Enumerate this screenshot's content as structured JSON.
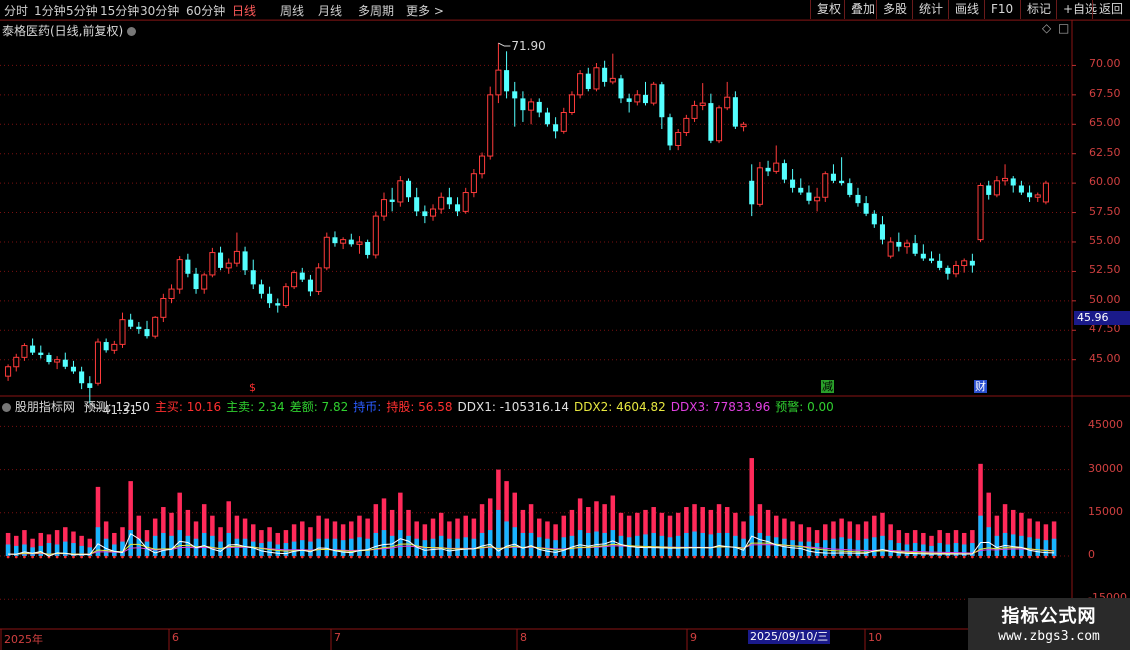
{
  "toolbar": {
    "periods": [
      "分时",
      "1分钟",
      "5分钟",
      "15分钟",
      "30分钟",
      "60分钟",
      "日线",
      "周线",
      "月线",
      "多周期",
      "更多 >"
    ],
    "active_period": "日线",
    "right_buttons": [
      "复权",
      "叠加",
      "多股",
      "统计",
      "画线",
      "F10",
      "标记",
      "+自选",
      "返回"
    ]
  },
  "chart_title": {
    "name": "泰格医药(日线,前复权)"
  },
  "price_panel": {
    "high_label": "71.90",
    "low_label": "41.31",
    "current_price": "45.96",
    "y_ticks": [
      "70.00",
      "67.50",
      "65.00",
      "62.50",
      "60.00",
      "57.50",
      "55.00",
      "52.50",
      "50.00",
      "47.50",
      "45.00"
    ],
    "markers": {
      "s_label": "$",
      "jian_label": "减",
      "cai_label": "财"
    }
  },
  "indicator": {
    "name": "股朋指标网",
    "fields": [
      {
        "label": "预测:",
        "value": "12.50",
        "color": "#e0e0e0"
      },
      {
        "label": "主买:",
        "value": "10.16",
        "color": "#ff3030"
      },
      {
        "label": "主卖:",
        "value": "2.34",
        "color": "#30d030"
      },
      {
        "label": "差额:",
        "value": "7.82",
        "color": "#30d030"
      },
      {
        "label": "持币:",
        "value": "",
        "color": "#2a5cff"
      },
      {
        "label": "持股:",
        "value": "56.58",
        "color": "#ff3030"
      },
      {
        "label": "DDX1:",
        "value": "-105316.14",
        "color": "#e0e0e0"
      },
      {
        "label": "DDX2:",
        "value": "4604.82",
        "color": "#e8e840"
      },
      {
        "label": "DDX3:",
        "value": "77833.96",
        "color": "#e040e0"
      },
      {
        "label": "预警:",
        "value": "0.00",
        "color": "#30d030"
      }
    ],
    "y_ticks": [
      "45000",
      "30000",
      "15000",
      "0",
      "-15000"
    ]
  },
  "x_axis": {
    "labels": [
      "2025年",
      "6",
      "7",
      "8",
      "9",
      "10"
    ],
    "cursor_date": "2025/09/10/三"
  },
  "watermark": {
    "line1": "指标公式网",
    "line2": "www.zbgs3.com"
  },
  "colors": {
    "up": "#ff3b3b",
    "down": "#54ffff",
    "grid": "#7a1010",
    "bar_red": "#ff2a5a",
    "bar_blue": "#19b4ff"
  },
  "chart_data": [
    {
      "type": "candlestick",
      "title": "泰格医药(日线,前复权)",
      "ylim": [
        42,
        72.5
      ],
      "y_ticks": [
        45.0,
        47.5,
        50.0,
        52.5,
        55.0,
        57.5,
        60.0,
        62.5,
        65.0,
        67.5,
        70.0
      ],
      "ohlc": [
        [
          43.6,
          44.6,
          43.2,
          44.4
        ],
        [
          44.4,
          45.5,
          44.0,
          45.2
        ],
        [
          45.2,
          46.4,
          44.9,
          46.2
        ],
        [
          46.2,
          46.8,
          45.4,
          45.6
        ],
        [
          45.6,
          46.2,
          45.1,
          45.4
        ],
        [
          45.4,
          45.6,
          44.6,
          44.8
        ],
        [
          44.8,
          45.3,
          44.2,
          45.0
        ],
        [
          45.0,
          45.6,
          44.2,
          44.4
        ],
        [
          44.4,
          44.9,
          43.8,
          44.0
        ],
        [
          44.0,
          44.4,
          42.5,
          43.0
        ],
        [
          43.0,
          43.6,
          41.31,
          42.6
        ],
        [
          43.0,
          46.8,
          42.8,
          46.5
        ],
        [
          46.5,
          46.8,
          45.6,
          45.8
        ],
        [
          45.8,
          46.6,
          45.5,
          46.3
        ],
        [
          46.3,
          49.0,
          46.0,
          48.4
        ],
        [
          48.4,
          48.9,
          47.6,
          47.8
        ],
        [
          47.8,
          48.2,
          47.2,
          47.6
        ],
        [
          47.6,
          48.3,
          46.8,
          47.0
        ],
        [
          47.0,
          48.7,
          46.8,
          48.6
        ],
        [
          48.6,
          50.6,
          48.2,
          50.2
        ],
        [
          50.2,
          51.4,
          49.8,
          51.0
        ],
        [
          51.0,
          53.8,
          50.6,
          53.5
        ],
        [
          53.5,
          54.0,
          52.0,
          52.3
        ],
        [
          52.3,
          52.8,
          50.6,
          51.0
        ],
        [
          51.0,
          52.4,
          50.6,
          52.2
        ],
        [
          52.2,
          54.5,
          52.0,
          54.1
        ],
        [
          54.1,
          54.6,
          52.6,
          52.8
        ],
        [
          52.8,
          53.6,
          52.3,
          53.2
        ],
        [
          53.2,
          55.8,
          52.9,
          54.2
        ],
        [
          54.2,
          54.6,
          52.2,
          52.6
        ],
        [
          52.6,
          53.5,
          51.0,
          51.4
        ],
        [
          51.4,
          51.8,
          50.2,
          50.6
        ],
        [
          50.6,
          51.2,
          49.4,
          49.8
        ],
        [
          49.8,
          50.2,
          49.0,
          49.6
        ],
        [
          49.6,
          51.5,
          49.4,
          51.2
        ],
        [
          51.2,
          52.6,
          51.0,
          52.4
        ],
        [
          52.4,
          52.8,
          51.6,
          51.8
        ],
        [
          51.8,
          52.2,
          50.4,
          50.8
        ],
        [
          50.8,
          53.2,
          50.5,
          52.8
        ],
        [
          52.8,
          55.8,
          52.6,
          55.4
        ],
        [
          55.4,
          55.9,
          54.6,
          54.9
        ],
        [
          54.9,
          55.4,
          54.4,
          55.2
        ],
        [
          55.2,
          55.7,
          54.6,
          54.8
        ],
        [
          54.8,
          55.5,
          54.0,
          55.0
        ],
        [
          55.0,
          55.2,
          53.6,
          53.9
        ],
        [
          53.9,
          57.6,
          53.6,
          57.2
        ],
        [
          57.2,
          59.2,
          56.8,
          58.6
        ],
        [
          58.6,
          59.6,
          57.6,
          58.4
        ],
        [
          58.4,
          60.6,
          58.0,
          60.2
        ],
        [
          60.2,
          60.4,
          58.4,
          58.8
        ],
        [
          58.8,
          59.6,
          57.2,
          57.6
        ],
        [
          57.6,
          58.1,
          56.6,
          57.2
        ],
        [
          57.2,
          58.2,
          56.8,
          57.8
        ],
        [
          57.8,
          59.2,
          57.4,
          58.8
        ],
        [
          58.8,
          59.6,
          57.8,
          58.2
        ],
        [
          58.2,
          58.8,
          57.2,
          57.6
        ],
        [
          57.6,
          59.6,
          57.4,
          59.2
        ],
        [
          59.2,
          61.2,
          58.8,
          60.8
        ],
        [
          60.8,
          62.6,
          60.4,
          62.3
        ],
        [
          62.3,
          68.2,
          62.0,
          67.5
        ],
        [
          67.5,
          71.9,
          66.8,
          69.6
        ],
        [
          69.6,
          71.2,
          67.2,
          67.8
        ],
        [
          67.8,
          68.6,
          64.8,
          67.2
        ],
        [
          67.2,
          67.8,
          65.2,
          66.2
        ],
        [
          66.2,
          67.2,
          65.0,
          66.9
        ],
        [
          66.9,
          67.2,
          65.6,
          66.0
        ],
        [
          66.0,
          66.4,
          64.8,
          65.0
        ],
        [
          65.0,
          65.6,
          63.8,
          64.4
        ],
        [
          64.4,
          66.4,
          64.2,
          66.0
        ],
        [
          66.0,
          67.8,
          65.8,
          67.5
        ],
        [
          67.5,
          69.6,
          67.2,
          69.3
        ],
        [
          69.3,
          69.8,
          67.8,
          68.0
        ],
        [
          68.0,
          70.2,
          67.8,
          69.8
        ],
        [
          69.8,
          70.4,
          68.2,
          68.6
        ],
        [
          68.6,
          71.0,
          68.4,
          68.9
        ],
        [
          68.9,
          69.2,
          66.8,
          67.2
        ],
        [
          67.2,
          67.6,
          66.0,
          66.9
        ],
        [
          66.9,
          67.9,
          66.6,
          67.5
        ],
        [
          67.5,
          68.6,
          66.6,
          66.8
        ],
        [
          66.8,
          68.6,
          66.6,
          68.4
        ],
        [
          68.4,
          68.6,
          64.6,
          65.6
        ],
        [
          65.6,
          65.9,
          62.8,
          63.2
        ],
        [
          63.2,
          64.6,
          62.8,
          64.3
        ],
        [
          64.3,
          65.8,
          64.0,
          65.5
        ],
        [
          65.5,
          67.0,
          65.2,
          66.6
        ],
        [
          66.6,
          68.5,
          66.2,
          66.8
        ],
        [
          66.8,
          67.6,
          63.4,
          63.6
        ],
        [
          63.6,
          66.6,
          63.4,
          66.4
        ],
        [
          66.4,
          68.6,
          66.2,
          67.3
        ],
        [
          67.3,
          67.8,
          64.6,
          64.8
        ],
        [
          64.8,
          65.2,
          64.4,
          65.0
        ],
        [
          60.2,
          61.6,
          57.2,
          58.2
        ],
        [
          58.2,
          61.8,
          58.0,
          61.3
        ],
        [
          61.3,
          61.9,
          60.6,
          61.0
        ],
        [
          61.0,
          63.2,
          60.8,
          61.7
        ],
        [
          61.7,
          62.0,
          60.0,
          60.3
        ],
        [
          60.3,
          61.2,
          59.2,
          59.6
        ],
        [
          59.6,
          60.4,
          59.0,
          59.2
        ],
        [
          59.2,
          59.8,
          58.2,
          58.5
        ],
        [
          58.5,
          59.6,
          57.6,
          58.8
        ],
        [
          58.8,
          61.0,
          58.4,
          60.8
        ],
        [
          60.8,
          61.6,
          60.0,
          60.2
        ],
        [
          60.2,
          62.2,
          59.8,
          60.0
        ],
        [
          60.0,
          60.4,
          58.8,
          59.0
        ],
        [
          59.0,
          59.6,
          58.0,
          58.3
        ],
        [
          58.3,
          58.9,
          57.2,
          57.4
        ],
        [
          57.4,
          57.7,
          56.2,
          56.5
        ],
        [
          56.5,
          57.2,
          54.8,
          55.2
        ],
        [
          53.8,
          55.4,
          53.6,
          55.0
        ],
        [
          55.0,
          55.8,
          54.2,
          54.6
        ],
        [
          54.6,
          55.2,
          54.0,
          54.9
        ],
        [
          54.9,
          55.6,
          53.8,
          54.0
        ],
        [
          54.0,
          54.8,
          53.4,
          53.6
        ],
        [
          53.6,
          54.2,
          53.2,
          53.4
        ],
        [
          53.4,
          54.0,
          52.6,
          52.8
        ],
        [
          52.8,
          53.0,
          51.8,
          52.3
        ],
        [
          52.3,
          53.4,
          52.0,
          53.0
        ],
        [
          53.0,
          53.6,
          52.4,
          53.4
        ],
        [
          53.4,
          54.0,
          52.4,
          53.0
        ],
        [
          55.2,
          60.0,
          55.0,
          59.8
        ],
        [
          59.8,
          60.2,
          58.6,
          59.0
        ],
        [
          59.0,
          60.6,
          58.8,
          60.2
        ],
        [
          60.2,
          61.6,
          59.8,
          60.4
        ],
        [
          60.4,
          60.6,
          59.2,
          59.8
        ],
        [
          59.8,
          60.2,
          59.0,
          59.2
        ],
        [
          59.2,
          59.8,
          58.4,
          58.8
        ],
        [
          58.8,
          59.2,
          58.4,
          59.0
        ],
        [
          58.4,
          60.2,
          58.2,
          60.0
        ]
      ]
    },
    {
      "type": "bar",
      "title": "股朋指标网",
      "ylim": [
        -25000,
        50000
      ],
      "y_ticks": [
        45000,
        30000,
        15000,
        0,
        -15000
      ],
      "series": [
        {
          "name": "主买",
          "color": "#ff2a5a",
          "values": [
            8000,
            7000,
            9000,
            6000,
            8000,
            7500,
            9000,
            10000,
            8500,
            7000,
            6000,
            24000,
            12000,
            8000,
            10000,
            26000,
            14000,
            9000,
            13000,
            17000,
            15000,
            22000,
            16000,
            12000,
            18000,
            14000,
            10000,
            19000,
            14000,
            13000,
            11000,
            9000,
            10000,
            8000,
            9000,
            11000,
            12000,
            10000,
            14000,
            13000,
            12000,
            11000,
            12000,
            14000,
            13000,
            18000,
            20000,
            16000,
            22000,
            16000,
            12000,
            11000,
            13000,
            15000,
            12000,
            13000,
            14000,
            13000,
            18000,
            20000,
            30000,
            26000,
            22000,
            16000,
            18000,
            13000,
            12000,
            11000,
            14000,
            16000,
            20000,
            17000,
            19000,
            18000,
            21000,
            15000,
            14000,
            15000,
            16000,
            17000,
            15000,
            14000,
            15000,
            17000,
            18000,
            17000,
            16000,
            18000,
            17000,
            15000,
            12000,
            34000,
            18000,
            16000,
            14000,
            13000,
            12000,
            11000,
            10000,
            9000,
            11000,
            12000,
            13000,
            12000,
            11000,
            12000,
            14000,
            15000,
            11000,
            9000,
            8000,
            9000,
            8000,
            7000,
            9000,
            8000,
            9000,
            8000,
            9000,
            32000,
            22000,
            14000,
            18000,
            16000,
            15000,
            13000,
            12000,
            11000,
            12000
          ]
        },
        {
          "name": "主卖",
          "color": "#19b4ff",
          "values": [
            4000,
            3500,
            4000,
            3000,
            3500,
            4500,
            4000,
            5000,
            4500,
            3500,
            3000,
            10000,
            6000,
            4000,
            5000,
            9000,
            6000,
            5000,
            7000,
            8000,
            7000,
            9000,
            7000,
            6000,
            8000,
            7000,
            5000,
            8000,
            6000,
            6000,
            5000,
            4500,
            5000,
            4000,
            4500,
            5000,
            5500,
            5000,
            6000,
            6000,
            6000,
            5500,
            6000,
            6500,
            6000,
            8000,
            9000,
            7000,
            9000,
            7000,
            6000,
            5500,
            6000,
            7000,
            6000,
            6000,
            6500,
            6000,
            8000,
            9000,
            16000,
            12000,
            10000,
            8000,
            8000,
            6500,
            6000,
            5500,
            6500,
            7000,
            9000,
            8000,
            8500,
            8000,
            9000,
            7000,
            6500,
            7000,
            7500,
            8000,
            7000,
            6500,
            7000,
            8000,
            8500,
            8000,
            7500,
            8000,
            8000,
            7000,
            6000,
            14000,
            8000,
            7000,
            6500,
            6000,
            5500,
            5000,
            5000,
            4500,
            5500,
            6000,
            6500,
            6000,
            5500,
            6000,
            6500,
            7000,
            5500,
            4500,
            4000,
            4500,
            4000,
            3500,
            4500,
            4000,
            4500,
            4000,
            4500,
            14000,
            10000,
            7000,
            8000,
            7500,
            7000,
            6500,
            6000,
            5500,
            6000
          ]
        }
      ]
    }
  ]
}
